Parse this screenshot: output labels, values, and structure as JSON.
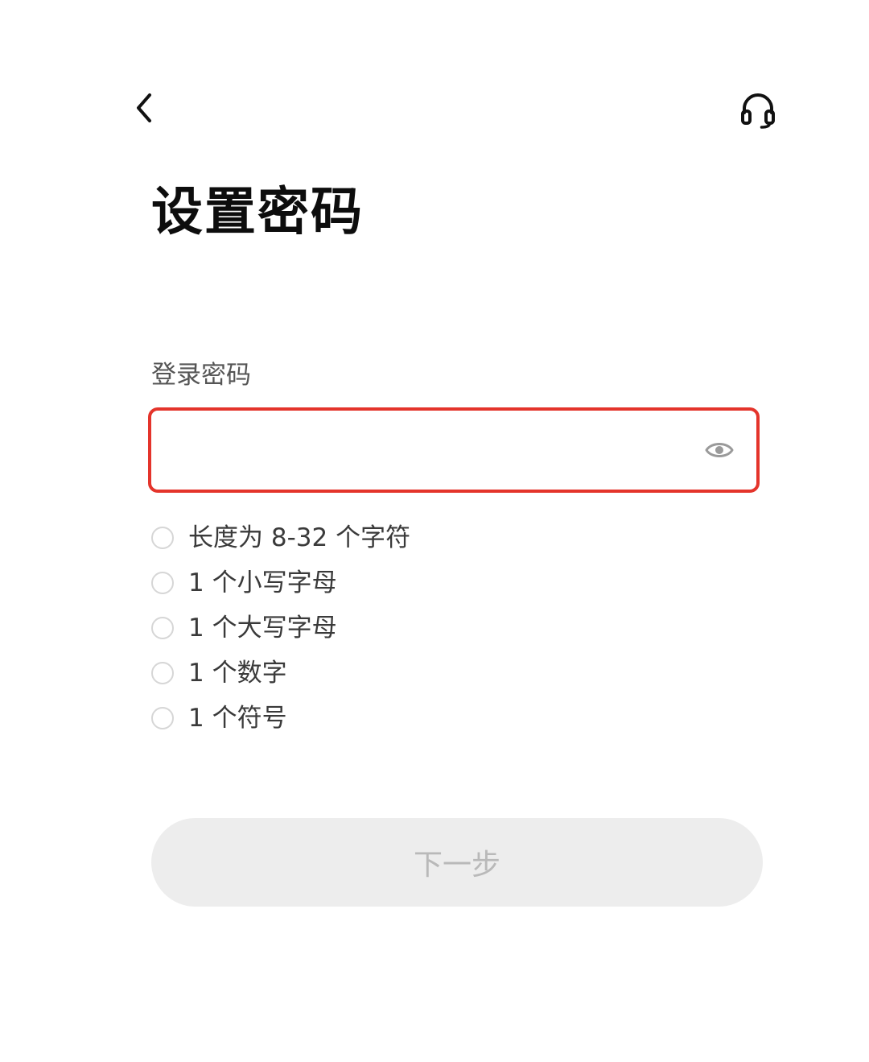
{
  "header": {
    "back_icon": "chevron-left-icon",
    "support_icon": "headset-icon"
  },
  "page": {
    "title": "设置密码"
  },
  "form": {
    "password_label": "登录密码",
    "password_value": "",
    "toggle_visibility_icon": "eye-icon",
    "focus_border_color": "#e4342b"
  },
  "rules": [
    {
      "text": "长度为 8-32 个字符",
      "satisfied": false
    },
    {
      "text": "1 个小写字母",
      "satisfied": false
    },
    {
      "text": "1 个大写字母",
      "satisfied": false
    },
    {
      "text": "1 个数字",
      "satisfied": false
    },
    {
      "text": "1 个符号",
      "satisfied": false
    }
  ],
  "footer": {
    "next_label": "下一步",
    "next_enabled": false
  }
}
